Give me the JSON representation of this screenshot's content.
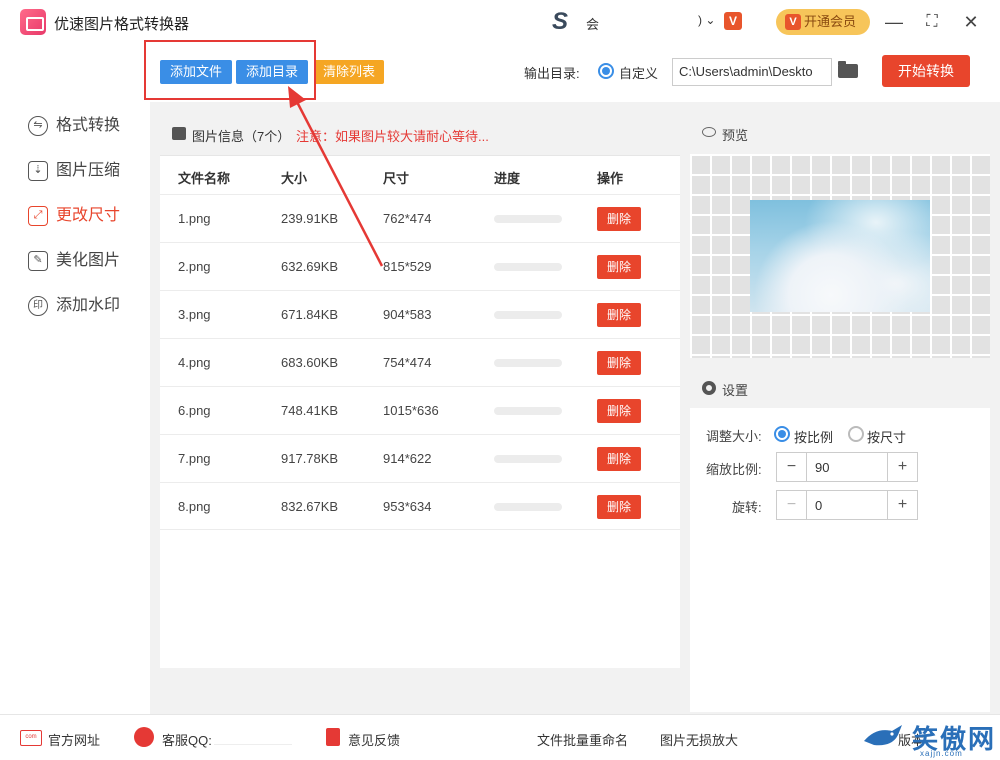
{
  "window": {
    "title": "优速图片格式转换器",
    "user_name": "会",
    "vip_label": "开通会员",
    "vip_icon": "V",
    "badge": "V"
  },
  "toolbar": {
    "add_file": "添加文件",
    "add_dir": "添加目录",
    "clear_list": "清除列表",
    "output_label": "输出目录:",
    "output_custom": "自定义",
    "output_path": "C:\\Users\\admin\\Deskto",
    "start": "开始转换"
  },
  "sidebar": {
    "items": [
      {
        "label": "格式转换",
        "icon": "format-convert-icon",
        "glyph": "⇋"
      },
      {
        "label": "图片压缩",
        "icon": "compress-icon",
        "glyph": "⇣"
      },
      {
        "label": "更改尺寸",
        "icon": "resize-icon",
        "glyph": "⤢",
        "active": true
      },
      {
        "label": "美化图片",
        "icon": "beautify-icon",
        "glyph": "✎"
      },
      {
        "label": "添加水印",
        "icon": "watermark-icon",
        "glyph": "印"
      }
    ]
  },
  "file_list": {
    "title": "图片信息（7个）",
    "note": "注意：如果图片较大请耐心等待...",
    "columns": [
      "文件名称",
      "大小",
      "尺寸",
      "进度",
      "操作"
    ],
    "rows": [
      {
        "name": "1.png",
        "size": "239.91KB",
        "dims": "762*474",
        "progress": 0,
        "action": "删除"
      },
      {
        "name": "2.png",
        "size": "632.69KB",
        "dims": "815*529",
        "progress": 0,
        "action": "删除"
      },
      {
        "name": "3.png",
        "size": "671.84KB",
        "dims": "904*583",
        "progress": 0,
        "action": "删除"
      },
      {
        "name": "4.png",
        "size": "683.60KB",
        "dims": "754*474",
        "progress": 0,
        "action": "删除"
      },
      {
        "name": "6.png",
        "size": "748.41KB",
        "dims": "1015*636",
        "progress": 0,
        "action": "删除"
      },
      {
        "name": "7.png",
        "size": "917.78KB",
        "dims": "914*622",
        "progress": 0,
        "action": "删除"
      },
      {
        "name": "8.png",
        "size": "832.67KB",
        "dims": "953*634",
        "progress": 0,
        "action": "删除"
      }
    ]
  },
  "preview": {
    "title": "预览"
  },
  "settings": {
    "title": "设置",
    "resize_label": "调整大小:",
    "opt_ratio": "按比例",
    "opt_size": "按尺寸",
    "scale_label": "缩放比例:",
    "scale_value": "90",
    "rotate_label": "旋转:",
    "rotate_value": "0"
  },
  "footer": {
    "website": "官方网址",
    "qq": "客服QQ:",
    "feedback": "意见反馈",
    "batch_rename": "文件批量重命名",
    "lossless": "图片无损放大",
    "version": "版本",
    "watermark_text": "笑傲网",
    "watermark_url": "xajjn.com"
  },
  "colors": {
    "accent_red": "#e8452c",
    "primary_blue": "#3a8ee6",
    "orange": "#f5a623"
  }
}
